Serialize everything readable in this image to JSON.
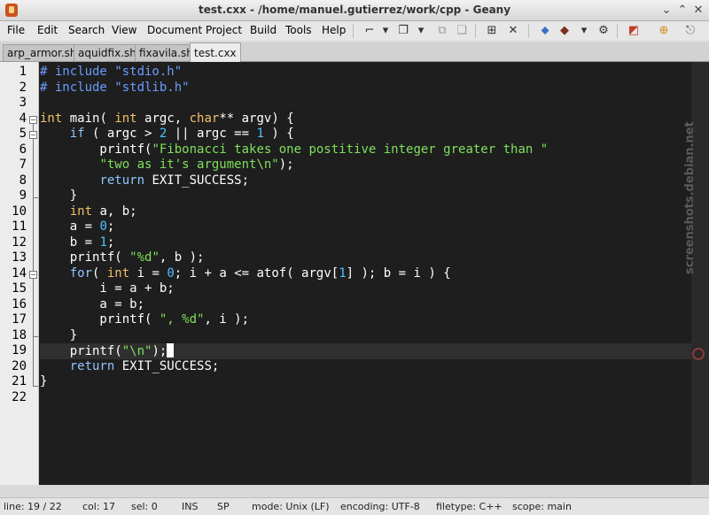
{
  "window": {
    "title": "test.cxx - /home/manuel.gutierrez/work/cpp - Geany"
  },
  "menu": [
    "File",
    "Edit",
    "Search",
    "View",
    "Document",
    "Project",
    "Build",
    "Tools",
    "Help"
  ],
  "tabs": [
    "arp_armor.sh",
    "aquidfix.sh",
    "fixavila.sh",
    "test.cxx"
  ],
  "editor": {
    "line_numbers": [
      "1",
      "2",
      "3",
      "4",
      "5",
      "6",
      "7",
      "8",
      "9",
      "10",
      "11",
      "12",
      "13",
      "14",
      "15",
      "16",
      "17",
      "18",
      "19",
      "20",
      "21",
      "22"
    ],
    "current_line": 19
  },
  "watermark": "screenshots.debian.net",
  "status": {
    "line": "line: 19 / 22",
    "col": "col: 17",
    "sel": "sel: 0",
    "ins": "INS",
    "sp": "SP",
    "mode": "mode: Unix (LF)",
    "encoding": "encoding: UTF-8",
    "filetype": "filetype: C++",
    "scope": "scope: main"
  },
  "colors": {
    "editor_bg": "#1e1e1e",
    "keyword": "#8fc6ff",
    "type": "#f2c166",
    "number": "#4fc1ff",
    "string": "#7ee05b"
  },
  "icons": [
    "new-file-icon",
    "open-file-icon",
    "save-icon",
    "save-all-icon",
    "reload-icon",
    "close-icon",
    "back-icon",
    "forward-icon",
    "compile-icon",
    "build-icon",
    "run-icon",
    "color-chooser-icon",
    "preferences-icon"
  ]
}
